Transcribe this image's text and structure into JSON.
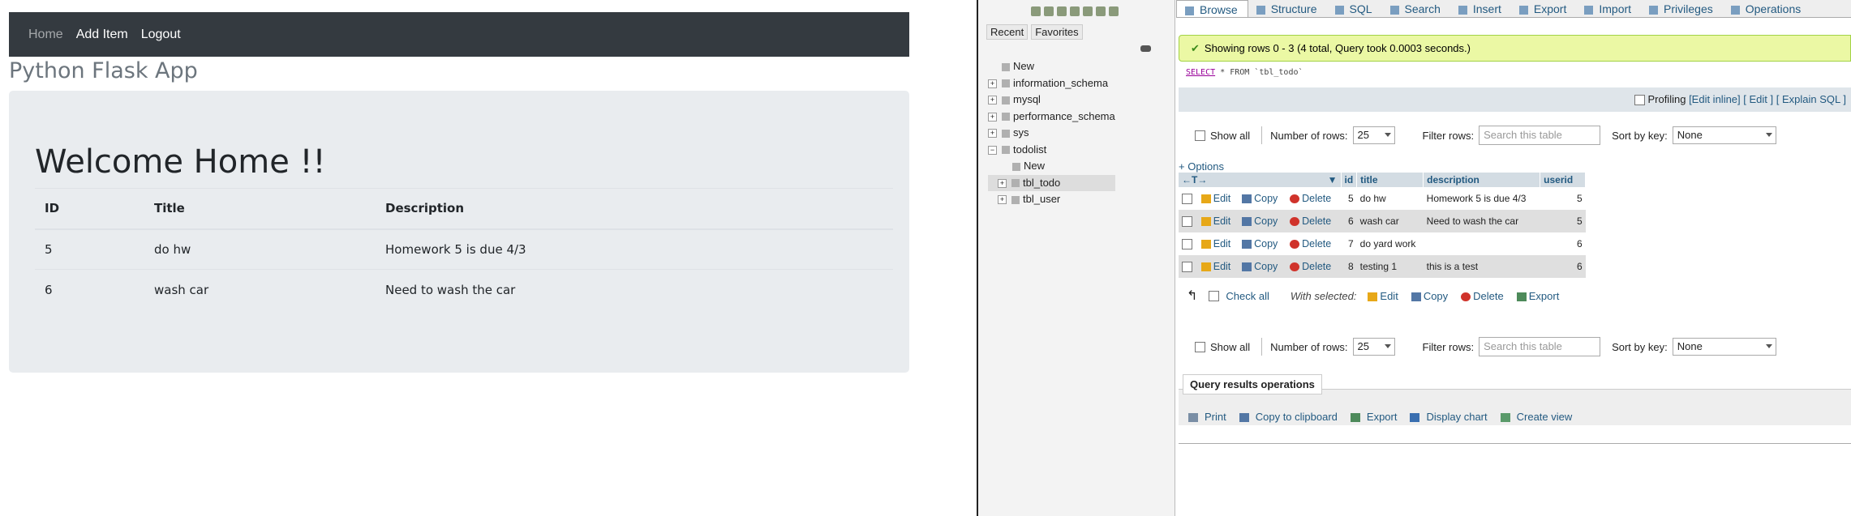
{
  "flask": {
    "nav": {
      "home": "Home",
      "add_item": "Add Item",
      "logout": "Logout"
    },
    "title": "Python Flask App",
    "welcome": "Welcome Home !!",
    "headers": [
      "ID",
      "Title",
      "Description"
    ],
    "rows": [
      [
        "5",
        "do hw",
        "Homework 5 is due 4/3"
      ],
      [
        "6",
        "wash car",
        "Need to wash the car"
      ]
    ]
  },
  "pma_nav": {
    "recent": "Recent",
    "favorites": "Favorites",
    "tree": [
      "New",
      "information_schema",
      "mysql",
      "performance_schema",
      "sys",
      "todolist",
      "New",
      "tbl_todo",
      "tbl_user"
    ]
  },
  "pma_main": {
    "tabs": [
      "Browse",
      "Structure",
      "SQL",
      "Search",
      "Insert",
      "Export",
      "Import",
      "Privileges",
      "Operations"
    ],
    "success": "Showing rows 0 - 3 (4 total, Query took 0.0003 seconds.)",
    "sql_kw": "SELECT",
    "sql_rest": "* FROM `tbl_todo`",
    "profiling": "Profiling",
    "prof_links": [
      "[Edit inline]",
      "[ Edit ]",
      "[ Explain SQL ]"
    ],
    "show_all": "Show all",
    "num_rows_label": "Number of rows:",
    "num_rows": "25",
    "filter_label": "Filter rows:",
    "filter_placeholder": "Search this table",
    "sort_label": "Sort by key:",
    "sort_value": "None",
    "options": "+ Options",
    "columns": [
      "id",
      "title",
      "description",
      "userid"
    ],
    "actions": {
      "edit": "Edit",
      "copy": "Copy",
      "delete": "Delete"
    },
    "rows": [
      [
        "5",
        "do hw",
        "Homework 5 is due 4/3",
        "5"
      ],
      [
        "6",
        "wash car",
        "Need to wash the car",
        "5"
      ],
      [
        "7",
        "do yard work",
        "",
        "6"
      ],
      [
        "8",
        "testing 1",
        "this is a test",
        "6"
      ]
    ],
    "check_all": "Check all",
    "with_selected": "With selected:",
    "bulk": {
      "edit": "Edit",
      "copy": "Copy",
      "delete": "Delete",
      "export": "Export"
    },
    "qro_title": "Query results operations",
    "qro": [
      "Print",
      "Copy to clipboard",
      "Export",
      "Display chart",
      "Create view"
    ]
  }
}
